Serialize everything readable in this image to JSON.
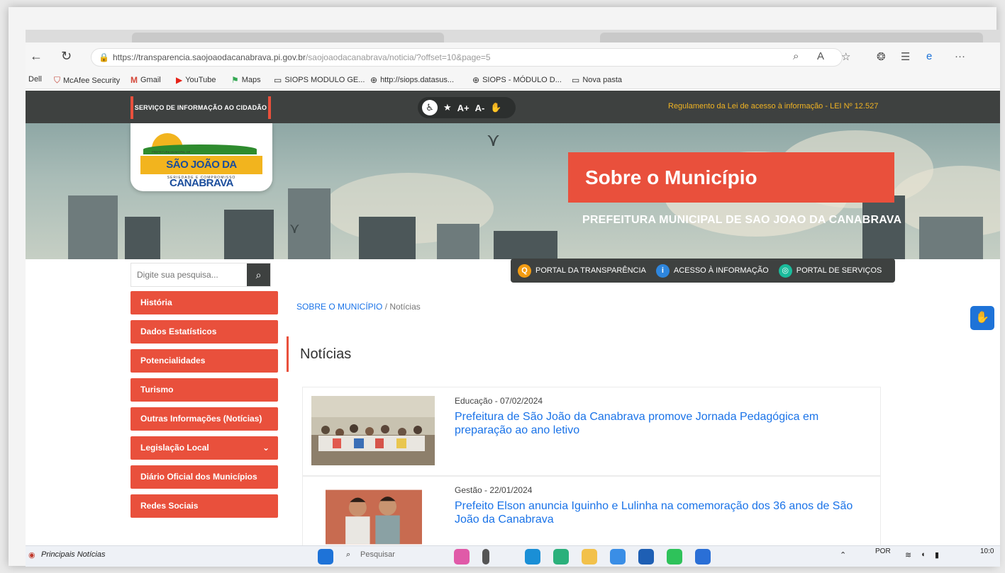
{
  "browser": {
    "url_main": "https://transparencia.saojoaodacanabrava.pi.gov.br",
    "url_path": "/saojoaodacanabrava/noticia/?offset=10&page=5",
    "bookmarks": [
      "Dell",
      "McAfee Security",
      "Gmail",
      "YouTube",
      "Maps",
      "SIOPS MODULO GE...",
      "http://siops.datasus...",
      "SIOPS - MÓDULO D...",
      "Nova pasta"
    ]
  },
  "site": {
    "sic_label": "SERVIÇO DE INFORMAÇÃO AO CIDADÃO",
    "a11y_font_up": "A+",
    "a11y_font_down": "A-",
    "lai_link": "Regulamento da Lei de acesso à informação - LEI Nº 12.527",
    "logo_text": "SÃO JOÃO DA CANABRAVA",
    "logo_top": "PREFEITURA MUNICIPAL DE",
    "logo_slogan": "SERIEDADE E COMPROMISSO",
    "page_title": "Sobre o Município",
    "prefeitura": "PREFEITURA MUNICIPAL DE SAO JOAO DA CANABRAVA",
    "quicklinks": [
      {
        "label": "PORTAL DA TRANSPARÊNCIA",
        "color": "#f39c12",
        "glyph": "Q"
      },
      {
        "label": "ACESSO À INFORMAÇÃO",
        "color": "#2e86de",
        "glyph": "i"
      },
      {
        "label": "PORTAL DE SERVIÇOS",
        "color": "#1abc9c",
        "glyph": "◎"
      }
    ],
    "search_placeholder": "Digite sua pesquisa...",
    "menu": [
      "História",
      "Dados Estatísticos",
      "Potencialidades",
      "Turismo",
      "Outras Informações (Notícias)",
      "Legislação Local",
      "Diário Oficial dos Municípios",
      "Redes Sociais"
    ],
    "breadcrumb_link": "SOBRE O MUNICÍPIO",
    "breadcrumb_sep": "/",
    "breadcrumb_current": "Notícias",
    "section_title": "Notícias",
    "news": [
      {
        "meta": "Educação - 07/02/2024",
        "title": "Prefeitura de São João da Canabrava promove Jornada Pedagógica em preparação ao ano letivo"
      },
      {
        "meta": "Gestão - 22/01/2024",
        "title": "Prefeito Elson anuncia Iguinho e Lulinha na comemoração dos 36 anos de São João da Canabrava"
      }
    ]
  },
  "taskbar": {
    "news_widget": "Principais Notícias",
    "search": "Pesquisar",
    "lang": "POR",
    "time": "10:0"
  },
  "colors": {
    "accent": "#e9503c",
    "dark": "#3e4140",
    "link": "#1a73e8"
  }
}
